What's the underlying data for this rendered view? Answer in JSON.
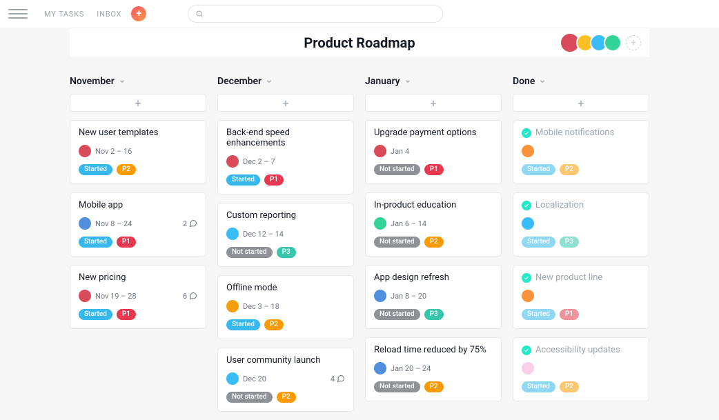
{
  "nav": {
    "myTasks": "MY TASKS",
    "inbox": "INBOX"
  },
  "search": {
    "placeholder": ""
  },
  "title": "Product Roadmap",
  "memberAvatars": [
    "av1",
    "av2",
    "av3",
    "av4"
  ],
  "columns": [
    {
      "name": "November",
      "cards": [
        {
          "title": "New user templates",
          "avatar": "av1",
          "date": "Nov 2 – 16",
          "status": "Started",
          "priority": "P2"
        },
        {
          "title": "Mobile app",
          "avatar": "av5",
          "date": "Nov 8 – 24",
          "comments": 2,
          "status": "Started",
          "priority": "P1"
        },
        {
          "title": "New pricing",
          "avatar": "av1",
          "date": "Nov 19 – 28",
          "comments": 6,
          "status": "Started",
          "priority": "P1"
        }
      ]
    },
    {
      "name": "December",
      "cards": [
        {
          "title": "Back-end speed enhancements",
          "avatar": "av1",
          "date": "Dec 2 – 7",
          "status": "Started",
          "priority": "P1"
        },
        {
          "title": "Custom reporting",
          "avatar": "av3",
          "date": "Dec 12 – 14",
          "status": "Not started",
          "priority": "P3"
        },
        {
          "title": "Offline mode",
          "avatar": "av6",
          "date": "Dec 3 – 18",
          "status": "Started",
          "priority": "P2"
        },
        {
          "title": "User community launch",
          "avatar": "av3",
          "date": "Dec 20",
          "comments": 4,
          "status": "Not started",
          "priority": "P2"
        }
      ]
    },
    {
      "name": "January",
      "cards": [
        {
          "title": "Upgrade payment options",
          "avatar": "av1",
          "date": "Jan 4",
          "status": "Not started",
          "priority": "P1"
        },
        {
          "title": "In-product education",
          "avatar": "av4",
          "date": "Jan 6 – 14",
          "status": "Not started",
          "priority": "P2"
        },
        {
          "title": "App design refresh",
          "avatar": "av5",
          "date": "Jan 8 – 20",
          "status": "Not started",
          "priority": "P3"
        },
        {
          "title": "Reload time reduced by 75%",
          "avatar": "av5",
          "date": "Jan 20 – 24",
          "status": "Not started",
          "priority": "P2"
        }
      ]
    },
    {
      "name": "Done",
      "muted": true,
      "cards": [
        {
          "title": "Mobile notifications",
          "avatar": "av7",
          "date": "",
          "status": "Started",
          "priority": "P2",
          "done": true
        },
        {
          "title": "Localization",
          "avatar": "av3",
          "date": "",
          "status": "Started",
          "priority": "P3",
          "done": true
        },
        {
          "title": "New product line",
          "avatar": "av7",
          "date": "",
          "status": "Started",
          "priority": "P1",
          "done": true
        },
        {
          "title": "Accessibility updates",
          "avatar": "av8",
          "date": "",
          "status": "Started",
          "priority": "P2",
          "done": true
        }
      ]
    }
  ]
}
